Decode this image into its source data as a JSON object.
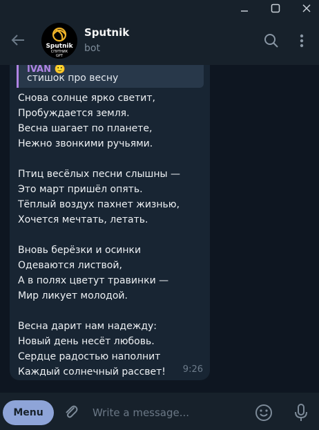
{
  "window": {
    "buttons": [
      "minimize",
      "maximize",
      "close"
    ]
  },
  "header": {
    "chat_name": "Sputnik",
    "status": "bot",
    "avatar": {
      "line1": "Sputnik",
      "line2": "СПУТНИК",
      "line3": "GPT"
    }
  },
  "message": {
    "reply": {
      "author": "IVAN 🙂",
      "text": "стишок про весну"
    },
    "text": "Снова солнце ярко светит,\nПробуждается земля.\nВесна шагает по планете,\nНежно звонкими ручьями.\n\nПтиц весёлых песни слышны —\nЭто март пришёл опять.\nТёплый воздух пахнет жизнью,\nХочется мечтать, летать.\n\nВновь берёзки и осинки\nОдеваются листвой,\nА в полях цветут травинки —\nМир ликует молодой.\n\nВесна дарит нам надежду:\nНовый день несёт любовь.\nСердце радостью наполнит\nКаждый солнечный рассвет!",
    "time": "9:26"
  },
  "composer": {
    "menu_label": "Menu",
    "placeholder": "Write a message..."
  },
  "colors": {
    "background": "#0e1621",
    "panel": "#17212b",
    "bubble": "#182533",
    "reply_accent": "#b084e4",
    "menu_button": "#8ea4d8"
  },
  "icons": [
    "minimize-icon",
    "maximize-icon",
    "close-icon",
    "back-arrow-icon",
    "search-icon",
    "more-vertical-icon",
    "attach-icon",
    "emoji-icon",
    "microphone-icon"
  ]
}
